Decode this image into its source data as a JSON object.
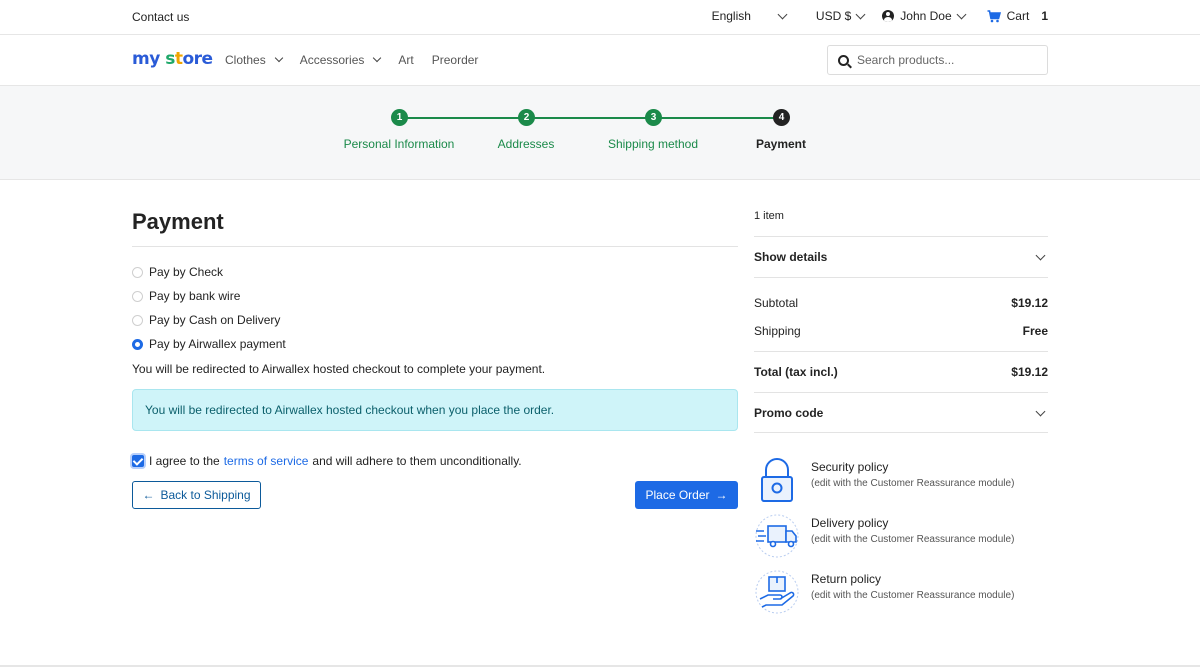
{
  "topbar": {
    "contact": "Contact us",
    "language": "English",
    "currency": "USD $",
    "user": "John Doe",
    "cart_label": "Cart",
    "cart_count": "1"
  },
  "header": {
    "logo": [
      "my",
      " ",
      "s",
      "t",
      "ore"
    ],
    "nav": [
      {
        "label": "Clothes",
        "dropdown": true
      },
      {
        "label": "Accessories",
        "dropdown": true
      },
      {
        "label": "Art",
        "dropdown": false
      },
      {
        "label": "Preorder",
        "dropdown": false
      }
    ],
    "search_placeholder": "Search products..."
  },
  "steps": [
    {
      "number": "1",
      "label": "Personal Information",
      "state": "done"
    },
    {
      "number": "2",
      "label": "Addresses",
      "state": "done"
    },
    {
      "number": "3",
      "label": "Shipping method",
      "state": "done"
    },
    {
      "number": "4",
      "label": "Payment",
      "state": "current"
    }
  ],
  "payment": {
    "title": "Payment",
    "options": [
      {
        "label": "Pay by Check",
        "selected": false
      },
      {
        "label": "Pay by bank wire",
        "selected": false
      },
      {
        "label": "Pay by Cash on Delivery",
        "selected": false
      },
      {
        "label": "Pay by Airwallex payment",
        "selected": true
      }
    ],
    "redirect_text": "You will be redirected to Airwallex hosted checkout to complete your payment.",
    "info_text": "You will be redirected to Airwallex hosted checkout when you place the order.",
    "terms_prefix": "I agree to the",
    "terms_link": "terms of service",
    "terms_suffix": "and will adhere to them unconditionally.",
    "terms_checked": true,
    "back_label": "Back to Shipping",
    "place_label": "Place Order"
  },
  "summary": {
    "item_count": "1 item",
    "show_details": "Show details",
    "subtotal_label": "Subtotal",
    "subtotal_value": "$19.12",
    "shipping_label": "Shipping",
    "shipping_value": "Free",
    "total_label": "Total (tax incl.)",
    "total_value": "$19.12",
    "promo_label": "Promo code"
  },
  "reassurance": [
    {
      "title": "Security policy",
      "subtitle": "(edit with the Customer Reassurance module)",
      "icon": "padlock-icon"
    },
    {
      "title": "Delivery policy",
      "subtitle": "(edit with the Customer Reassurance module)",
      "icon": "delivery-truck-icon"
    },
    {
      "title": "Return policy",
      "subtitle": "(edit with the Customer Reassurance module)",
      "icon": "return-hand-box-icon"
    }
  ],
  "colors": {
    "accent": "#1d6ae5",
    "step_done": "#1b8a4a",
    "info_bg": "#cff4f9"
  }
}
